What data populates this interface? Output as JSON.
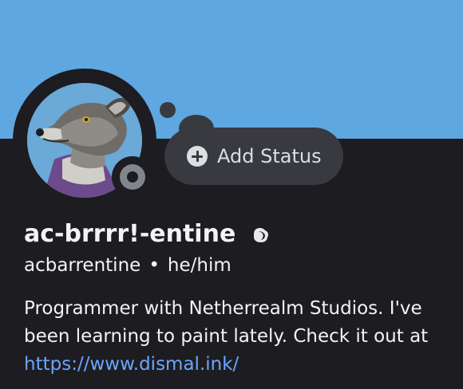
{
  "colors": {
    "banner": "#5ea7e0",
    "background": "#1d1c21",
    "status_pill": "#393940",
    "link": "#6aa6ff",
    "status_idle_gray": "#83858d"
  },
  "status": {
    "add_label": "Add Status",
    "icon": "plus-circle-icon"
  },
  "profile": {
    "display_name": "ac-brrrr!-entine",
    "badge_icon": "moon-badge-icon",
    "username": "acbarrentine",
    "separator": "•",
    "pronouns": "he/him",
    "avatar_icon": "greyhound-avatar",
    "presence_indicator": "offline-status-icon"
  },
  "bio": {
    "line1": "Programmer with Netherrealm Studios. I've",
    "line2": "been learning to paint lately. Check it out at",
    "link": "https://www.dismal.ink/"
  }
}
